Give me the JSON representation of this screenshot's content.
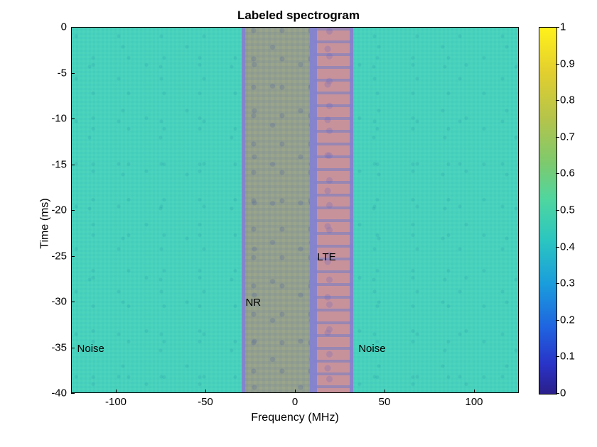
{
  "chart_data": {
    "type": "heatmap",
    "title": "Labeled spectrogram",
    "xlabel": "Frequency (MHz)",
    "ylabel": "Time (ms)",
    "x_range": [
      -125,
      125
    ],
    "y_range": [
      -40,
      0
    ],
    "x_ticks": [
      -100,
      -50,
      0,
      50,
      100
    ],
    "y_ticks": [
      0,
      -5,
      -10,
      -15,
      -20,
      -25,
      -30,
      -35,
      -40
    ],
    "colorbar": {
      "range": [
        0,
        1
      ],
      "ticks": [
        0,
        0.1,
        0.2,
        0.3,
        0.4,
        0.5,
        0.6,
        0.7,
        0.8,
        0.9,
        1
      ]
    },
    "regions": [
      {
        "label": "Noise",
        "freq_start": -125,
        "freq_end": -30,
        "type": "noise"
      },
      {
        "label": "NR",
        "freq_start": -30,
        "freq_end": 10,
        "type": "nr"
      },
      {
        "label": "LTE",
        "freq_start": 10,
        "freq_end": 32,
        "type": "lte"
      },
      {
        "label": "Noise",
        "freq_start": 32,
        "freq_end": 125,
        "type": "noise"
      }
    ],
    "annotations": [
      {
        "text": "Noise",
        "x": -122,
        "y": -35
      },
      {
        "text": "NR",
        "x": -28,
        "y": -30
      },
      {
        "text": "LTE",
        "x": 12,
        "y": -25
      },
      {
        "text": "Noise",
        "x": 35,
        "y": -35
      }
    ]
  }
}
